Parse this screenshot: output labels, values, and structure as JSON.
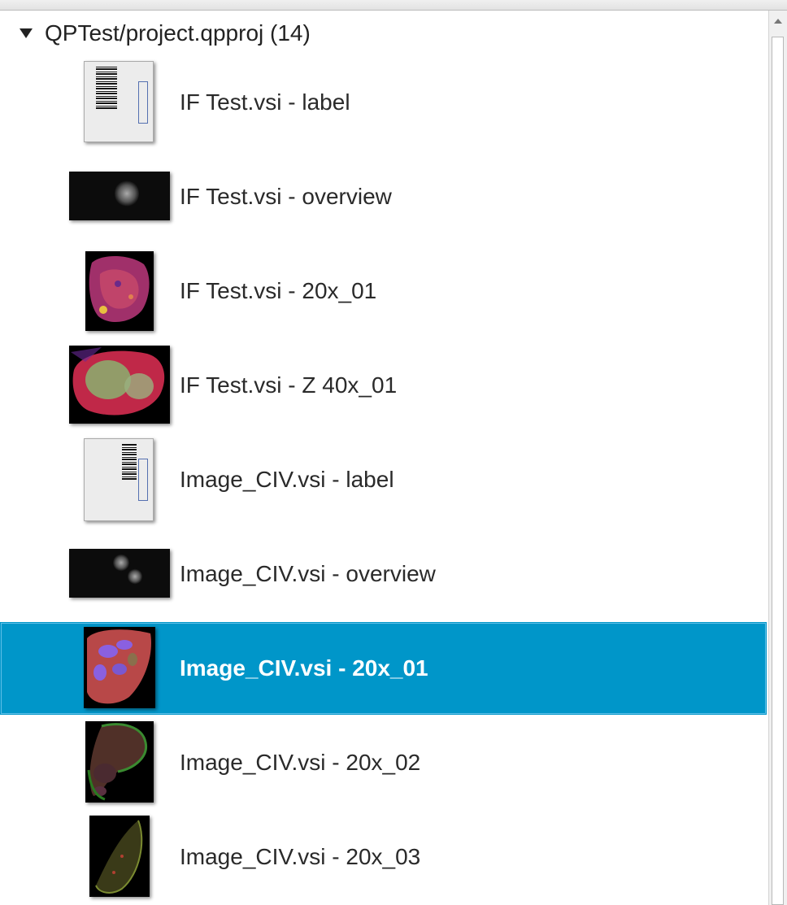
{
  "window": {
    "scrollbar": "vertical-scrollbar"
  },
  "tree": {
    "root": {
      "label": "QPTest/project.qpproj (14)",
      "expanded": true,
      "icon": "triangle-down-icon"
    },
    "items": [
      {
        "label": "IF Test.vsi - label",
        "thumbnail": "label-slide-thumbnail",
        "selected": false
      },
      {
        "label": "IF Test.vsi - overview",
        "thumbnail": "overview-thumbnail",
        "selected": false
      },
      {
        "label": "IF Test.vsi - 20x_01",
        "thumbnail": "tissue-thumbnail",
        "selected": false
      },
      {
        "label": "IF Test.vsi - Z 40x_01",
        "thumbnail": "tissue-thumbnail",
        "selected": false
      },
      {
        "label": "Image_CIV.vsi - label",
        "thumbnail": "label-slide-thumbnail",
        "selected": false
      },
      {
        "label": "Image_CIV.vsi - overview",
        "thumbnail": "overview-thumbnail",
        "selected": false
      },
      {
        "label": "Image_CIV.vsi - 20x_01",
        "thumbnail": "tissue-thumbnail",
        "selected": true
      },
      {
        "label": "Image_CIV.vsi - 20x_02",
        "thumbnail": "tissue-thumbnail",
        "selected": false
      },
      {
        "label": "Image_CIV.vsi - 20x_03",
        "thumbnail": "tissue-thumbnail",
        "selected": false
      }
    ]
  },
  "colors": {
    "selection": "#0096c9",
    "text": "#2a2a2a",
    "selected_text": "#ffffff"
  }
}
